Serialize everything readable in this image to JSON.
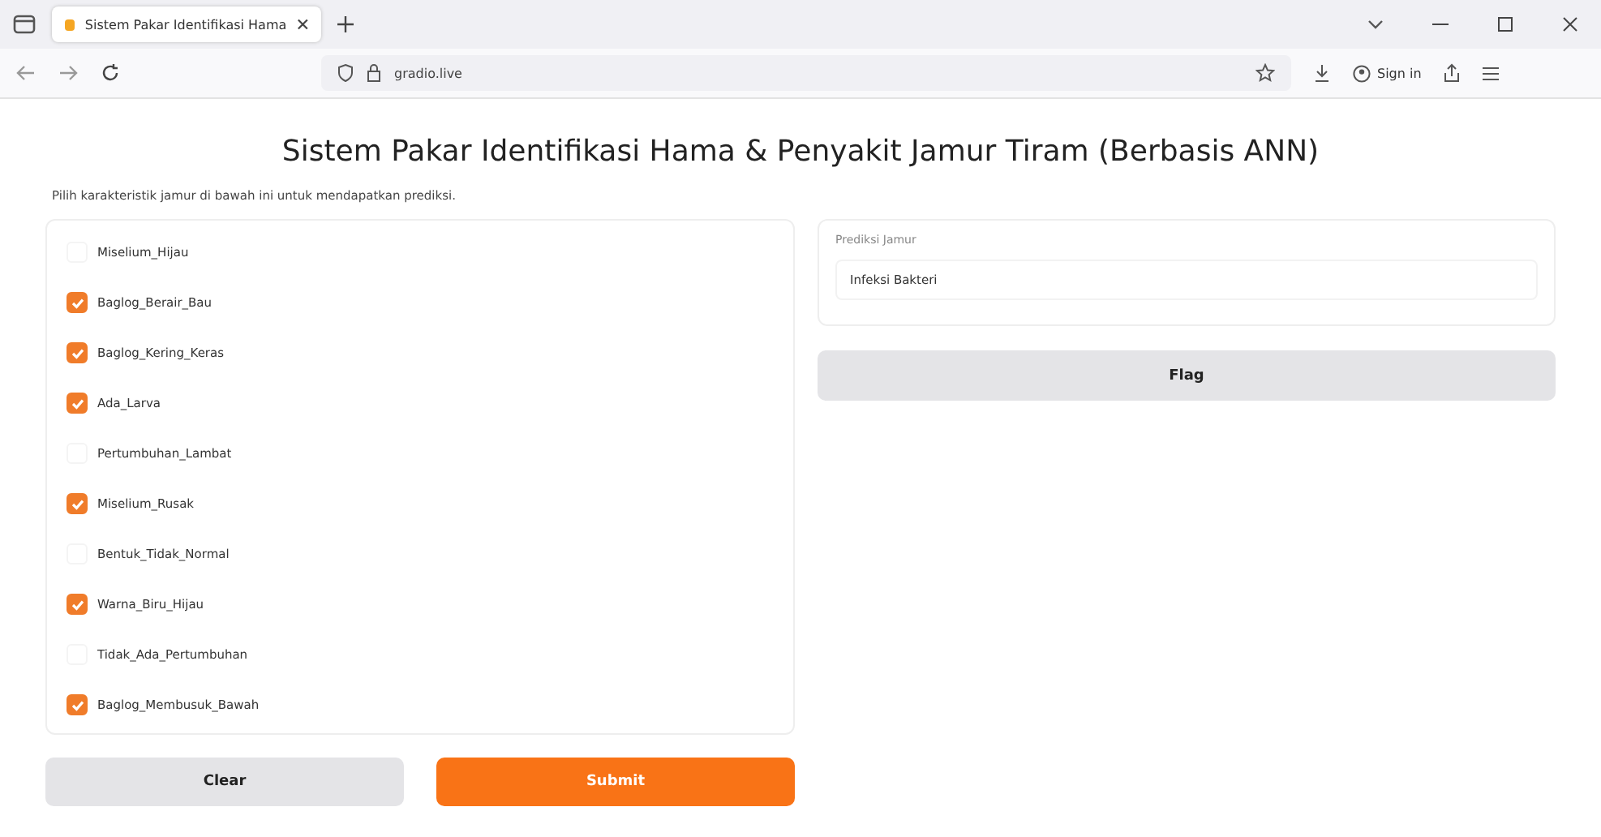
{
  "browser": {
    "tab_title": "Sistem Pakar Identifikasi Hama",
    "address": "gradio.live",
    "sign_in": "Sign in"
  },
  "title": "Sistem Pakar Identifikasi Hama & Penyakit Jamur Tiram (Berbasis ANN)",
  "description": "Pilih karakteristik jamur di bawah ini untuk mendapatkan prediksi.",
  "checkboxes": [
    {
      "label": "Miselium_Hijau",
      "checked": false
    },
    {
      "label": "Baglog_Berair_Bau",
      "checked": true
    },
    {
      "label": "Baglog_Kering_Keras",
      "checked": true
    },
    {
      "label": "Ada_Larva",
      "checked": true
    },
    {
      "label": "Pertumbuhan_Lambat",
      "checked": false
    },
    {
      "label": "Miselium_Rusak",
      "checked": true
    },
    {
      "label": "Bentuk_Tidak_Normal",
      "checked": false
    },
    {
      "label": "Warna_Biru_Hijau",
      "checked": true
    },
    {
      "label": "Tidak_Ada_Pertumbuhan",
      "checked": false
    },
    {
      "label": "Baglog_Membusuk_Bawah",
      "checked": true
    }
  ],
  "output": {
    "label": "Prediksi Jamur",
    "value": "Infeksi Bakteri"
  },
  "buttons": {
    "clear": "Clear",
    "submit": "Submit",
    "flag": "Flag"
  }
}
